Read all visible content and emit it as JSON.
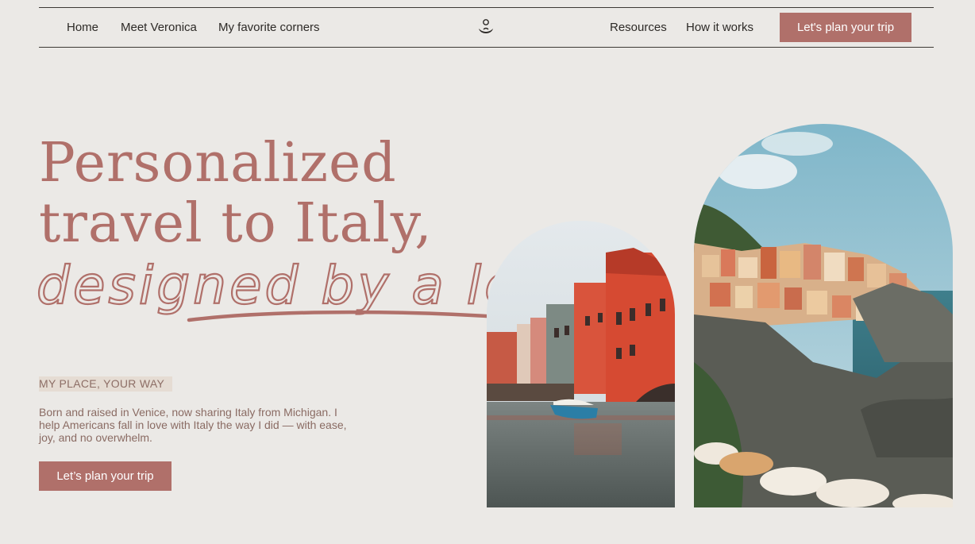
{
  "nav": {
    "left_links": [
      "Home",
      "Meet Veronica",
      "My favorite corners"
    ],
    "right_links": [
      "Resources",
      "How it works"
    ],
    "cta": "Let's plan your trip",
    "logo_icon": "meditating-figure-logo-icon"
  },
  "hero": {
    "headline_line1": "Personalized",
    "headline_line2": "travel to Italy,",
    "script_line": "designed by a local",
    "eyebrow": "MY PLACE, YOUR WAY",
    "intro": "Born and raised in Venice, now sharing Italy from Michigan. I help Americans fall in love with Italy the way I did — with ease, joy, and no overwhelm.",
    "cta": "Let’s plan your trip"
  },
  "images": {
    "left": "venice-canal-photo",
    "right": "cinque-terre-cliff-village-photo"
  },
  "colors": {
    "background": "#ebe9e6",
    "accent": "#b0706a",
    "text": "#2d2a27",
    "body_text": "#8a6b63",
    "eyebrow_highlight": "#e5dcd3"
  }
}
